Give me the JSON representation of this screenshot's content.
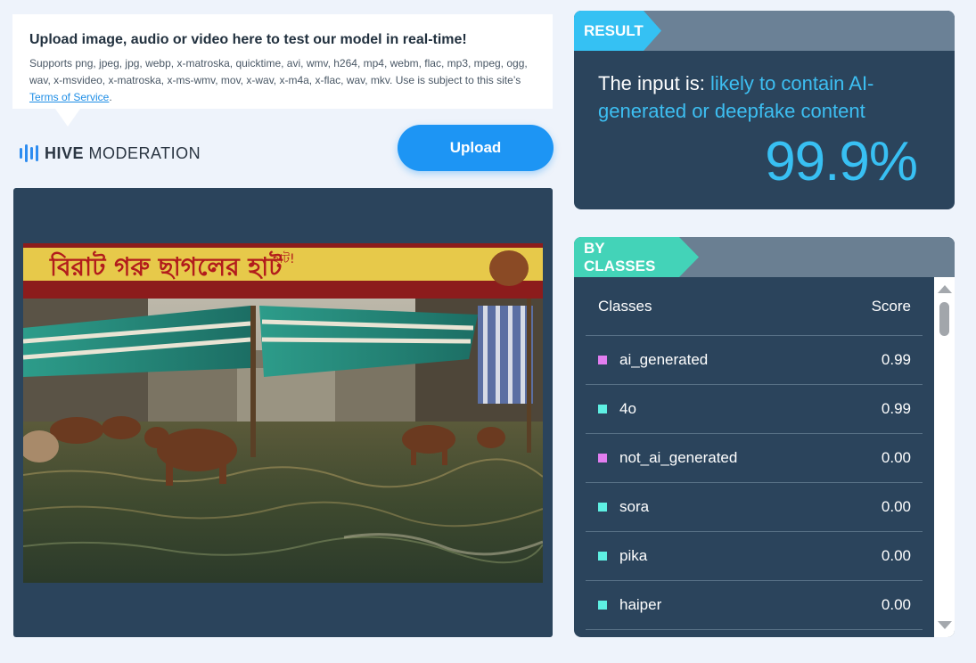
{
  "upload_info": {
    "title": "Upload image, audio or video here to test our model in real-time!",
    "description": "Supports png, jpeg, jpg, webp, x-matroska, quicktime, avi, wmv, h264, mp4, webm, flac, mp3, mpeg, ogg, wav, x-msvideo, x-matroska, x-ms-wmv, mov, x-wav, x-m4a, x-flac, wav, mkv. Use is subject to this site’s ",
    "terms_link": "Terms of Service",
    "terms_suffix": "."
  },
  "logo": {
    "brand_bold": "HIVE",
    "brand_rest": " MODERATION",
    "color": "#2d8cf0"
  },
  "upload_button": {
    "label": "Upload",
    "color": "#1d95f4"
  },
  "preview": {
    "banner_text": "বিরাট গরু ছাগলের হাট",
    "banner_subtext": "হাট!"
  },
  "result": {
    "tag": "RESULT",
    "prefix": "The input is: ",
    "verdict": "likely to contain AI-generated or deepfake content",
    "score": "99.9%",
    "accent": "#35c1f3"
  },
  "by_classes": {
    "tag": "BY CLASSES",
    "accent": "#43d3b8",
    "header": {
      "classes": "Classes",
      "score": "Score"
    },
    "rows": [
      {
        "name": "ai_generated",
        "score": "0.99",
        "color": "#e27ef0"
      },
      {
        "name": "4o",
        "score": "0.99",
        "color": "#5ef0e3"
      },
      {
        "name": "not_ai_generated",
        "score": "0.00",
        "color": "#e27ef0"
      },
      {
        "name": "sora",
        "score": "0.00",
        "color": "#5ef0e3"
      },
      {
        "name": "pika",
        "score": "0.00",
        "color": "#5ef0e3"
      },
      {
        "name": "haiper",
        "score": "0.00",
        "color": "#5ef0e3"
      }
    ]
  }
}
